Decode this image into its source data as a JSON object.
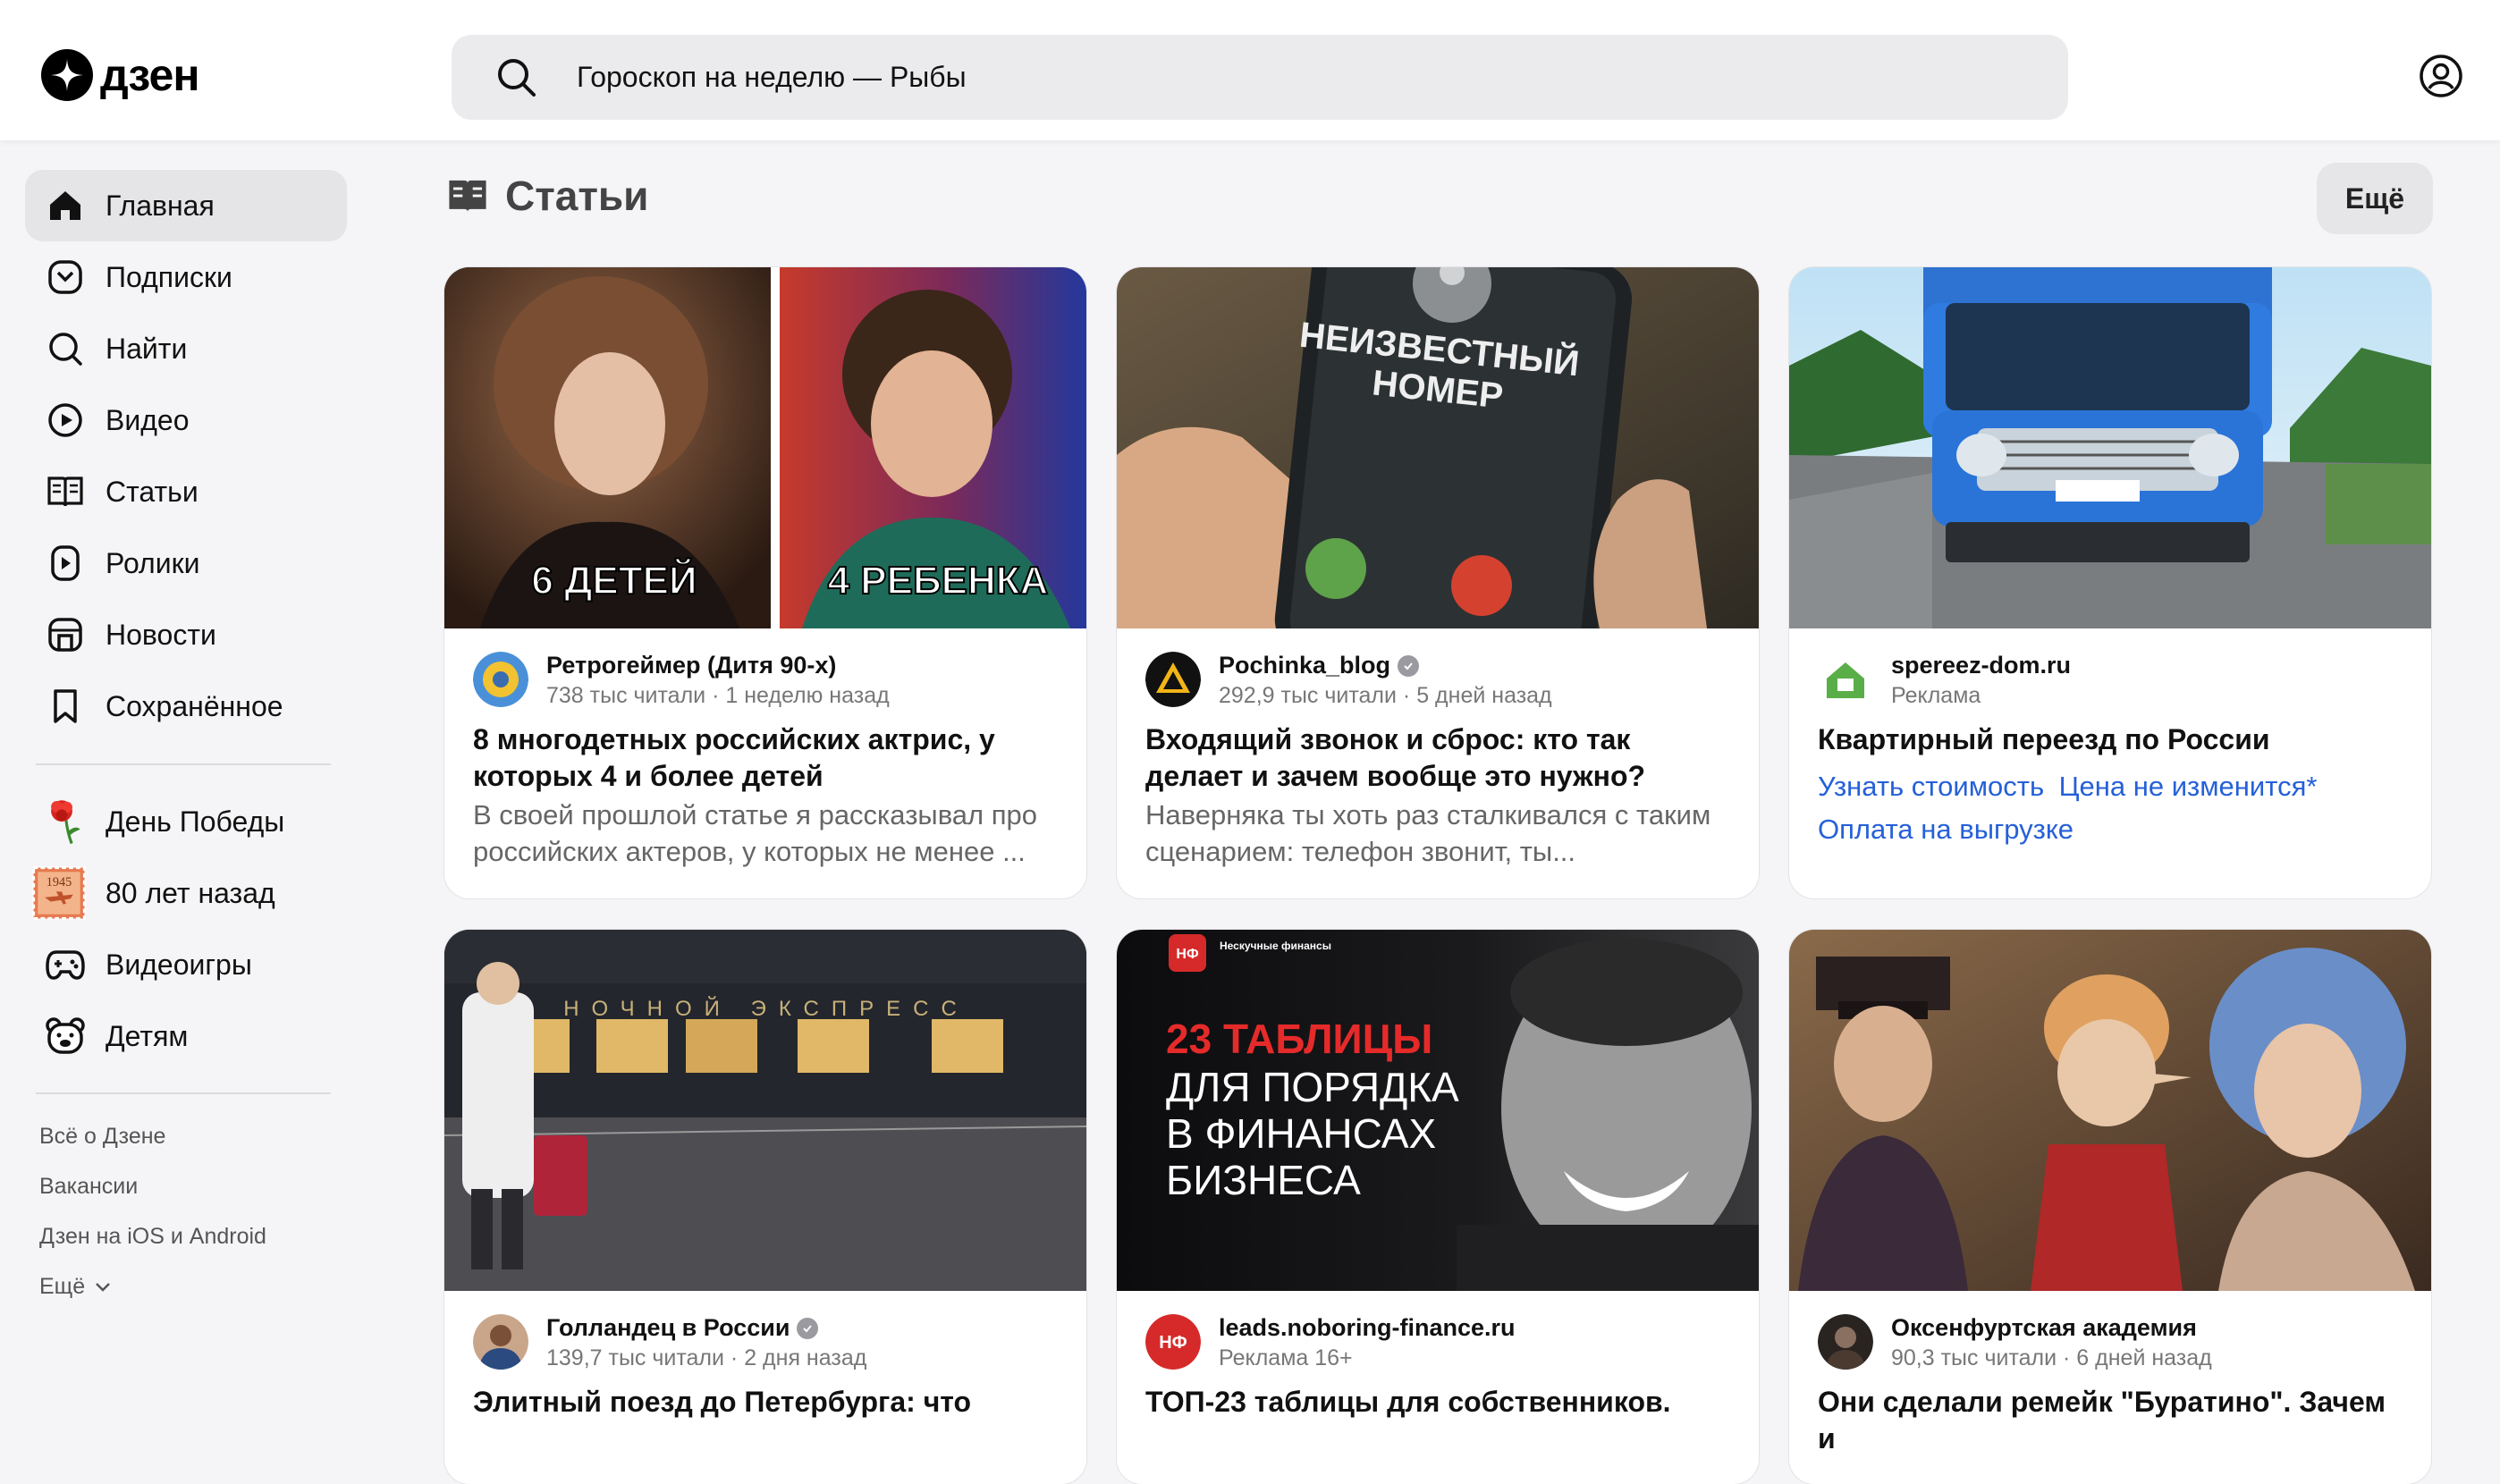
{
  "header": {
    "logo_text": "дзен",
    "search_value": "Гороскоп на неделю — Рыбы"
  },
  "sidebar": {
    "items": [
      {
        "label": "Главная",
        "icon": "home-icon"
      },
      {
        "label": "Подписки",
        "icon": "subscriptions-icon"
      },
      {
        "label": "Найти",
        "icon": "search-icon"
      },
      {
        "label": "Видео",
        "icon": "video-icon"
      },
      {
        "label": "Статьи",
        "icon": "articles-icon"
      },
      {
        "label": "Ролики",
        "icon": "shorts-icon"
      },
      {
        "label": "Новости",
        "icon": "news-icon"
      },
      {
        "label": "Сохранённое",
        "icon": "bookmark-icon"
      }
    ],
    "special": [
      {
        "label": "День Победы",
        "icon": "carnation-icon"
      },
      {
        "label": "80 лет назад",
        "icon": "stamp-1945-icon",
        "stamp_text": "1945"
      },
      {
        "label": "Видеоигры",
        "icon": "gamepad-icon"
      },
      {
        "label": "Детям",
        "icon": "bear-icon"
      }
    ],
    "footer": [
      "Всё о Дзене",
      "Вакансии",
      "Дзен на iOS и Android",
      "Ещё"
    ]
  },
  "section": {
    "title": "Статьи",
    "more_label": "Ещё"
  },
  "cards": [
    {
      "source": "Ретрогеймер (Дитя 90-х)",
      "meta": "738 тыс читали · 1 неделю назад",
      "title": "8 многодетных российских актрис, у которых 4 и более детей",
      "desc": "В своей прошлой статье я рассказывал про российских актеров, у которых не менее ...",
      "image_caption_left": "6 ДЕТЕЙ",
      "image_caption_right": "4 РЕБЕНКА"
    },
    {
      "source": "Pochinka_blog",
      "meta": "292,9 тыс читали · 5 дней назад",
      "title": "Входящий звонок и сброс: кто так делает и зачем вообще это нужно?",
      "desc": "Наверняка ты хоть раз сталкивался с таким сценарием: телефон звонит, ты...",
      "image_text_1": "НЕИЗВЕСТНЫЙ",
      "image_text_2": "НОМЕР"
    },
    {
      "source": "spereez-dom.ru",
      "meta": "Реклама",
      "title": "Квартирный переезд по России",
      "links": [
        "Узнать стоимость",
        "Цена не изменится*",
        "Оплата на выгрузке"
      ]
    },
    {
      "source": "Голландец в России",
      "meta": "139,7 тыс читали · 2 дня назад",
      "title": "Элитный поезд до Петербурга: что",
      "image_text": "НОЧНОЙ ЭКСПРЕСС"
    },
    {
      "source": "leads.noboring-finance.ru",
      "meta": "Реклама 16+",
      "title": "ТОП-23 таблицы для собственников.",
      "image_badge": "НФ",
      "image_brand": "Нескучные финансы",
      "image_red": "23 ТАБЛИЦЫ",
      "image_white_1": "ДЛЯ ПОРЯДКА",
      "image_white_2": "В ФИНАНСАХ",
      "image_white_3": "БИЗНЕСА"
    },
    {
      "source": "Оксенфуртская академия",
      "meta": "90,3 тыс читали · 6 дней назад",
      "title": "Они сделали ремейк \"Буратино\". Зачем и"
    }
  ]
}
